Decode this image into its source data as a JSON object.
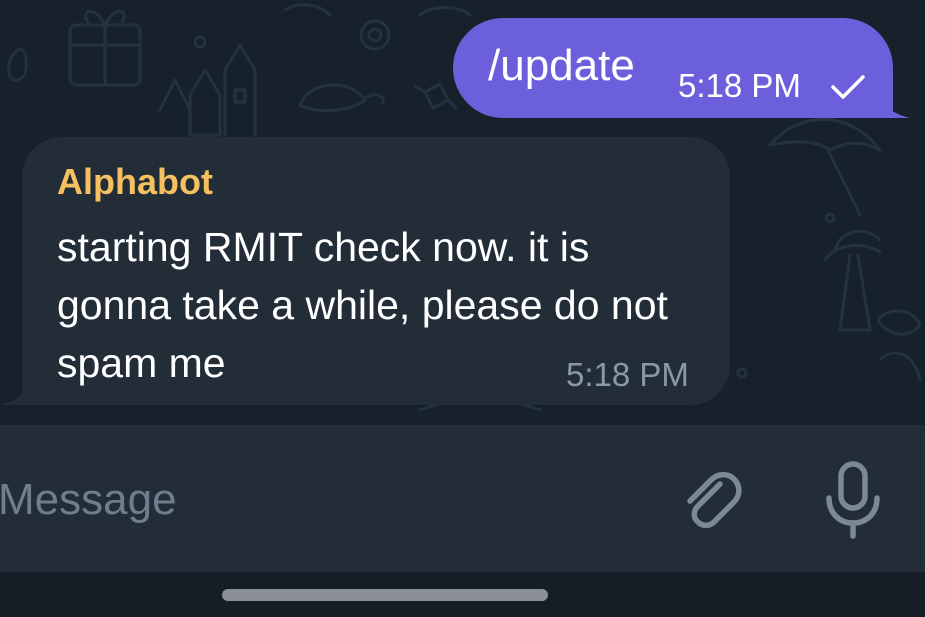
{
  "outgoing_message": {
    "text": "/update",
    "time": "5:18 PM",
    "status_icon": "check-icon"
  },
  "incoming_message": {
    "sender": "Alphabot",
    "text": "starting RMIT check now. it is gonna take a while, please do not spam me",
    "time": "5:18 PM"
  },
  "input_bar": {
    "placeholder": "Message",
    "attach_icon": "paperclip-icon",
    "voice_icon": "microphone-icon"
  },
  "colors": {
    "background": "#17212b",
    "outgoing_bubble": "#6c5fdb",
    "incoming_bubble": "#222d38",
    "sender_name": "#f5c05f",
    "time_muted": "#8b98a6",
    "placeholder": "#6f7d8c"
  }
}
